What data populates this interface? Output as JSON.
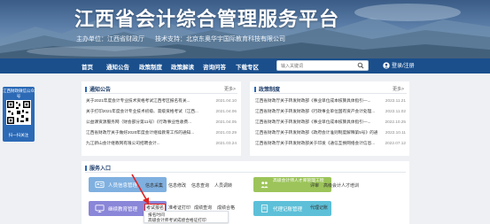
{
  "header": {
    "title": "江西省会计综合管理服务平台",
    "host_label": "主办单位：江西省财政厅",
    "support_label": "技术支持：北京东奥华宇国际教育科技有限公司"
  },
  "nav": {
    "items": [
      "首页",
      "通知公告",
      "政策制度",
      "政策解读",
      "咨询问答",
      "下载专区"
    ],
    "search_placeholder": "输入关键词",
    "login_label": "登录/注册"
  },
  "qr": {
    "title": "江西财政微信公众号",
    "footer": "扫一扫关注"
  },
  "notices": {
    "heading": "通知公告",
    "more": "更多>",
    "rows": [
      {
        "text": "关于2021年度会计专业技术资格考试江西考区报名有关...",
        "date": "2021.04.10"
      },
      {
        "text": "关于打印2021年度会计专业技术初级、高级资格考试（江西...",
        "date": "2021.04.06"
      },
      {
        "text": "公益课资源服务网（财会部分第11号）《行政事业性收费...",
        "date": "2021.04.05"
      },
      {
        "text": "江西省财政厅关于做好2020年度会计继续教育工作的通知...",
        "date": "2021.03.29"
      },
      {
        "text": "九江新山会计继教网有限公司招聘会计...",
        "date": "2021.03.24"
      }
    ]
  },
  "policies": {
    "heading": "政策制度",
    "more": "更多>",
    "rows": [
      {
        "text": "江西省财政厅关于转发财政部《事业单位成本核算具体指引—...",
        "date": "2022.11.21"
      },
      {
        "text": "江西省财政厅关于转发财政部《行政事业单位国有资产会计处理...",
        "date": "2022.11.02"
      },
      {
        "text": "江西省财政厅关于转发财政部《事业单位成本核算具体指引—...",
        "date": "2022.10.25"
      },
      {
        "text": "江西省财政厅关于转发财政部《政府会计准则制度解释第5号》的通知",
        "date": "2022.10.11"
      },
      {
        "text": "江西省财政厅关于转发财政部关于印发《通信互换网络会计信息...",
        "date": "2022.07.12"
      }
    ]
  },
  "services": {
    "heading": "服务入口",
    "tiles": [
      {
        "label": "人员信息管理",
        "color": "#7fb0e0"
      },
      {
        "label": "高级会计师人才库管理工程",
        "color": "#9cc45a"
      },
      {
        "label": "继续教育管理",
        "color": "#8a86d8"
      },
      {
        "label": "代理记账管理",
        "color": "#5dc0d8"
      }
    ],
    "links_row1_left": [
      "信息采集",
      "信息修改",
      "信息查询",
      "人员调转"
    ],
    "links_row1_right": [
      "评审",
      "高级会计人才培训"
    ],
    "links_row2_left": [
      "考试报名",
      "准考证打印",
      "成绩查询",
      "成绩合格"
    ],
    "links_row2_right": [
      "代理记账"
    ],
    "dropdown": [
      "报名时间",
      "高级会计师考试成绩合格证打印"
    ]
  },
  "colors": {
    "nav_bg": "#1a4f8c",
    "highlight": "#e02020",
    "accent": "#2c6ab6"
  }
}
